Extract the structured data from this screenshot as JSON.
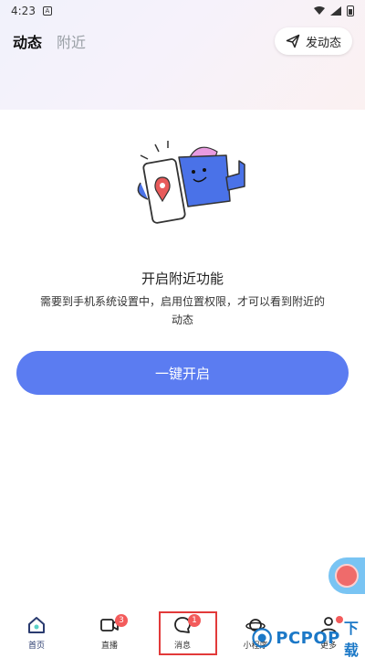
{
  "statusbar": {
    "time": "4:23",
    "app_glyph": "A"
  },
  "header": {
    "tabs": [
      {
        "label": "动态",
        "active": true
      },
      {
        "label": "附近",
        "active": false
      }
    ],
    "post_button_label": "发动态",
    "post_button_icon": "send-icon"
  },
  "main": {
    "illustration": "location-permission-illustration",
    "title": "开启附近功能",
    "description": "需要到手机系统设置中，启用位置权限，才可以看到附近的动态",
    "enable_button_label": "一键开启"
  },
  "bottom_nav": [
    {
      "label": "首页",
      "icon": "home-icon",
      "active": true,
      "badge": ""
    },
    {
      "label": "直播",
      "icon": "video-icon",
      "active": false,
      "badge": "3"
    },
    {
      "label": "消息",
      "icon": "chat-icon",
      "active": false,
      "badge": "1"
    },
    {
      "label": "小程序",
      "icon": "planet-icon",
      "active": false,
      "badge": ""
    },
    {
      "label": "更多",
      "icon": "person-icon",
      "active": false,
      "badge": "dot"
    }
  ],
  "watermark": {
    "text": "PCPOP",
    "suffix": "下载"
  },
  "colors": {
    "accent": "#5b7cf1",
    "badge": "#f35b5b",
    "highlight": "#e23a3a"
  }
}
